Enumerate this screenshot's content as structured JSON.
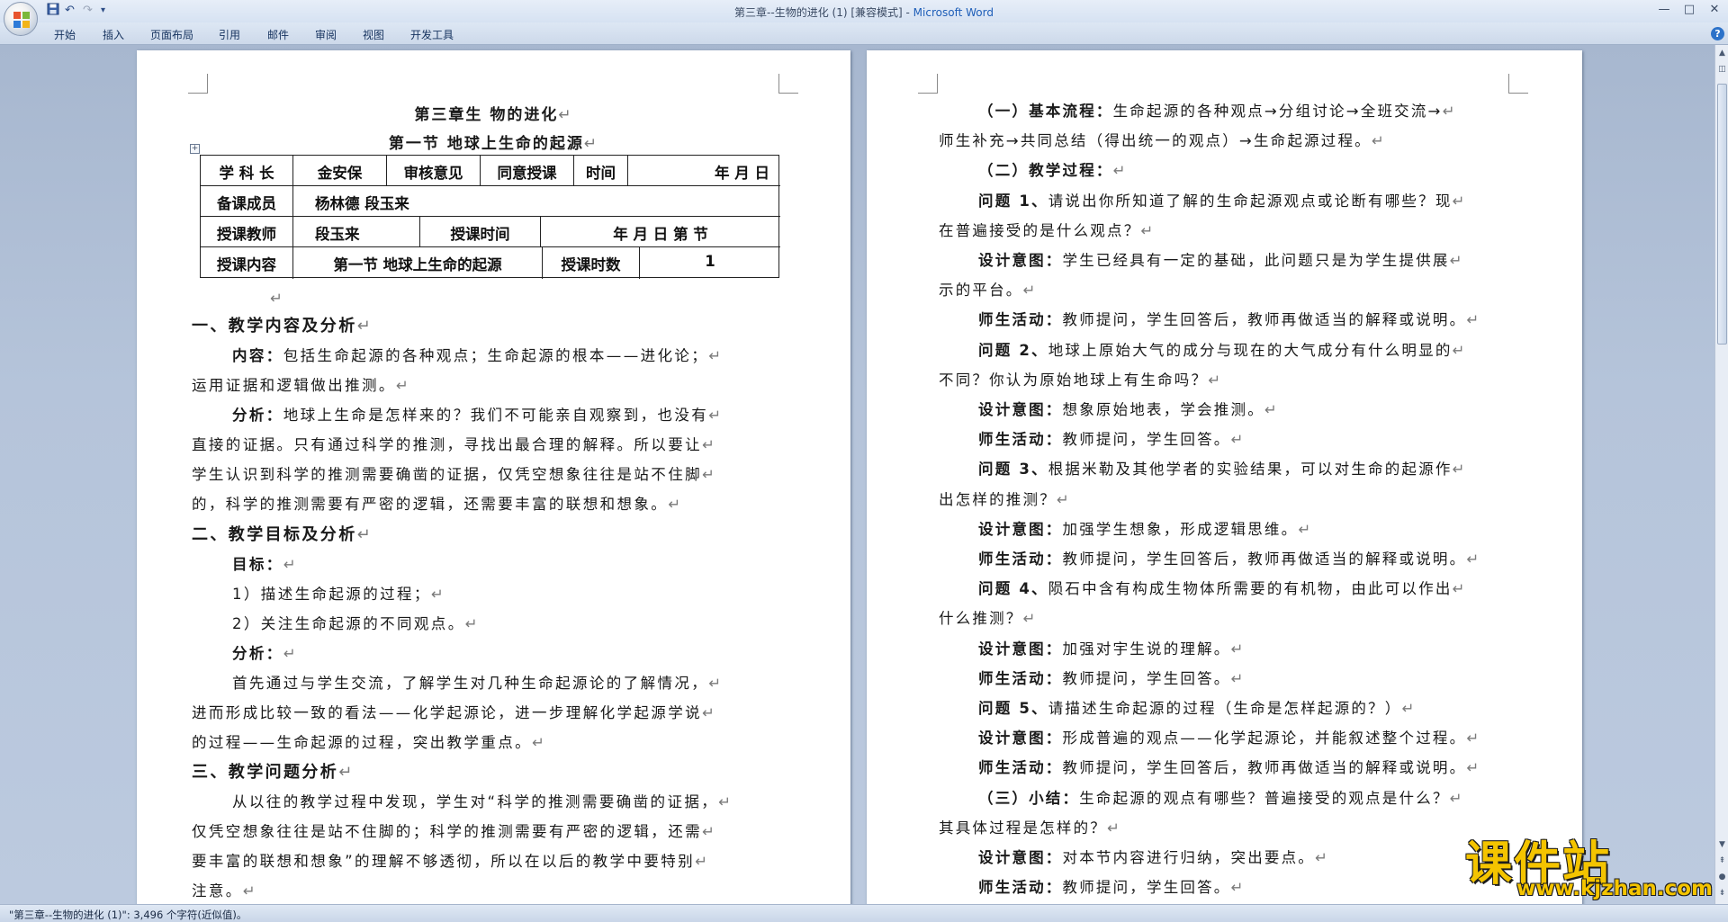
{
  "window": {
    "title": "第三章--生物的进化 (1) [兼容模式] -",
    "app_name": "Microsoft Word",
    "controls": {
      "minimize": "—",
      "maximize": "□",
      "close": "✕"
    }
  },
  "quick_access": {
    "save_icon": "save-icon",
    "undo": "↶",
    "redo": "↷",
    "more": "▾"
  },
  "ribbon": {
    "tabs": [
      "开始",
      "插入",
      "页面布局",
      "引用",
      "邮件",
      "审阅",
      "视图",
      "开发工具"
    ],
    "help": "?"
  },
  "left_page": {
    "chapter_title": "第三章生  物的进化",
    "section_title": "第一节  地球上生命的起源",
    "table": {
      "row1": {
        "subject_head_label": "学 科 长",
        "subject_head": "金安保",
        "review_label": "审核意见",
        "review_value": "同意授课",
        "time_label": "时间",
        "time_value": "年    月    日"
      },
      "row2": {
        "members_label": "备课成员",
        "members_value": "杨林德    段玉来"
      },
      "row3": {
        "teacher_label": "授课教师",
        "teacher_value": "段玉来",
        "lesson_time_label": "授课时间",
        "lesson_time_value": "年   月   日   第    节"
      },
      "row4": {
        "content_label": "授课内容",
        "content_value": "第一节  地球上生命的起源",
        "hours_label": "授课时数",
        "hours_value": "1"
      }
    },
    "lines": [
      {
        "style": "h",
        "indent": 0,
        "text": "一、教学内容及分析"
      },
      {
        "style": "p",
        "indent": 1,
        "bold": "内容：",
        "text": "包括生命起源的各种观点；生命起源的根本——进化论；"
      },
      {
        "style": "p",
        "indent": 0,
        "text": "运用证据和逻辑做出推测。"
      },
      {
        "style": "p",
        "indent": 1,
        "bold": "分析：",
        "text": "地球上生命是怎样来的？我们不可能亲自观察到，也没有"
      },
      {
        "style": "p",
        "indent": 0,
        "text": "直接的证据。只有通过科学的推测，寻找出最合理的解释。所以要让"
      },
      {
        "style": "p",
        "indent": 0,
        "text": "学生认识到科学的推测需要确凿的证据，仅凭空想象往往是站不住脚"
      },
      {
        "style": "p",
        "indent": 0,
        "text": "的，科学的推测需要有严密的逻辑，还需要丰富的联想和想象。"
      },
      {
        "style": "h",
        "indent": 0,
        "text": "二、教学目标及分析"
      },
      {
        "style": "p",
        "indent": 1,
        "bold": "目标：",
        "text": ""
      },
      {
        "style": "p",
        "indent": 1,
        "text": "1）描述生命起源的过程；"
      },
      {
        "style": "p",
        "indent": 1,
        "text": "2）关注生命起源的不同观点。"
      },
      {
        "style": "p",
        "indent": 1,
        "bold": "分析：",
        "text": ""
      },
      {
        "style": "p",
        "indent": 1,
        "text": "首先通过与学生交流，了解学生对几种生命起源论的了解情况，"
      },
      {
        "style": "p",
        "indent": 0,
        "text": "进而形成比较一致的看法——化学起源论，进一步理解化学起源学说"
      },
      {
        "style": "p",
        "indent": 0,
        "text": "的过程——生命起源的过程，突出教学重点。"
      },
      {
        "style": "h",
        "indent": 0,
        "text": "三、教学问题分析"
      },
      {
        "style": "p",
        "indent": 1,
        "text": "从以往的教学过程中发现，学生对“科学的推测需要确凿的证据，"
      },
      {
        "style": "p",
        "indent": 0,
        "text": "仅凭空想象往往是站不住脚的；科学的推测需要有严密的逻辑，还需"
      },
      {
        "style": "p",
        "indent": 0,
        "text": "要丰富的联想和想象”的理解不够透彻，所以在以后的教学中要特别"
      },
      {
        "style": "p",
        "indent": 0,
        "text": "注意。"
      }
    ]
  },
  "right_page": {
    "lines": [
      {
        "indent": 1,
        "bold": "（一）基本流程：",
        "text": "生命起源的各种观点→分组讨论→全班交流→"
      },
      {
        "indent": 0,
        "text": "师生补充→共同总结（得出统一的观点）→生命起源过程。"
      },
      {
        "indent": 1,
        "bold": "（二）教学过程：",
        "text": ""
      },
      {
        "indent": 1,
        "bold": "问题 1、",
        "text": "请说出你所知道了解的生命起源观点或论断有哪些？现"
      },
      {
        "indent": 0,
        "text": "在普遍接受的是什么观点？"
      },
      {
        "indent": 1,
        "bold": "设计意图：",
        "text": "学生已经具有一定的基础，此问题只是为学生提供展"
      },
      {
        "indent": 0,
        "text": "示的平台。"
      },
      {
        "indent": 1,
        "bold": "师生活动：",
        "text": "教师提问，学生回答后，教师再做适当的解释或说明。"
      },
      {
        "indent": 1,
        "bold": "问题 2、",
        "text": "地球上原始大气的成分与现在的大气成分有什么明显的"
      },
      {
        "indent": 0,
        "text": "不同？你认为原始地球上有生命吗？"
      },
      {
        "indent": 1,
        "bold": "设计意图：",
        "text": "想象原始地表，学会推测。"
      },
      {
        "indent": 1,
        "bold": "师生活动：",
        "text": "教师提问，学生回答。"
      },
      {
        "indent": 1,
        "bold": "问题 3、",
        "text": "根据米勒及其他学者的实验结果，可以对生命的起源作"
      },
      {
        "indent": 0,
        "text": "出怎样的推测？"
      },
      {
        "indent": 1,
        "bold": "设计意图：",
        "text": "加强学生想象，形成逻辑思维。"
      },
      {
        "indent": 1,
        "bold": "师生活动：",
        "text": "教师提问，学生回答后，教师再做适当的解释或说明。"
      },
      {
        "indent": 1,
        "bold": "问题 4、",
        "text": "陨石中含有构成生物体所需要的有机物，由此可以作出"
      },
      {
        "indent": 0,
        "text": "什么推测？"
      },
      {
        "indent": 1,
        "bold": "设计意图：",
        "text": "加强对宇生说的理解。"
      },
      {
        "indent": 1,
        "bold": "师生活动：",
        "text": "教师提问，学生回答。"
      },
      {
        "indent": 1,
        "bold": "问题 5、",
        "text": "请描述生命起源的过程（生命是怎样起源的？）"
      },
      {
        "indent": 1,
        "bold": "设计意图：",
        "text": "形成普遍的观点——化学起源论，并能叙述整个过程。"
      },
      {
        "indent": 1,
        "bold": "师生活动：",
        "text": "教师提问，学生回答后，教师再做适当的解释或说明。"
      },
      {
        "indent": 1,
        "bold": "（三）小结：",
        "text": "生命起源的观点有哪些？普遍接受的观点是什么？"
      },
      {
        "indent": 0,
        "text": "其具体过程是怎样的？"
      },
      {
        "indent": 1,
        "bold": "设计意图：",
        "text": "对本节内容进行归纳，突出要点。"
      },
      {
        "indent": 1,
        "bold": "师生活动：",
        "text": "教师提问，学生回答。"
      }
    ]
  },
  "status_bar": {
    "text": "\"第三章--生物的进化 (1)\": 3,496 个字符(近似值)。"
  },
  "watermark": {
    "text": "课件站",
    "url": "www.kjzhan.com"
  },
  "colors": {
    "accent": "#1e5eb8",
    "workspace": "#b5c4da",
    "watermark": "#f4c400"
  }
}
